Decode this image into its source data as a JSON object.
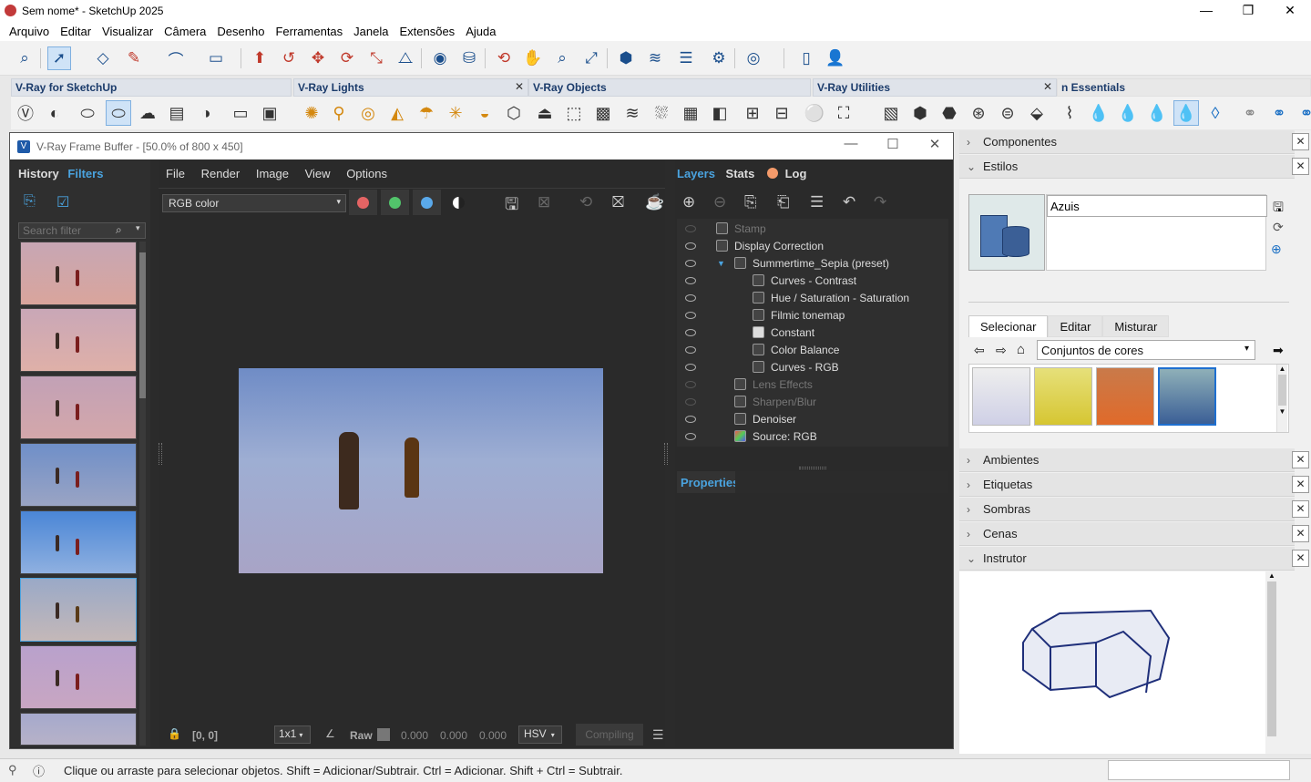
{
  "window": {
    "title": "Sem nome* - SketchUp 2025"
  },
  "menu": [
    "Arquivo",
    "Editar",
    "Visualizar",
    "Câmera",
    "Desenho",
    "Ferramentas",
    "Janela",
    "Extensões",
    "Ajuda"
  ],
  "toolbars": {
    "vray_sketchup": "V-Ray for SketchUp",
    "vray_lights": "V-Ray Lights",
    "vray_objects": "V-Ray Objects",
    "vray_utilities": "V-Ray Utilities",
    "essentials": "n Essentials",
    "close_glyph": "✕"
  },
  "vfb": {
    "title": "V-Ray Frame Buffer - [50.0% of 800 x 450]",
    "left_tabs": [
      "History",
      "Filters"
    ],
    "search_placeholder": "Search filter",
    "menu": [
      "File",
      "Render",
      "Image",
      "View",
      "Options"
    ],
    "channel": "RGB color",
    "right_tabs": [
      "Layers",
      "Stats",
      "Log"
    ],
    "layers": [
      {
        "label": "Stamp",
        "dim": true
      },
      {
        "label": "Display Correction",
        "dim": false
      },
      {
        "label": "Summertime_Sepia (preset)",
        "dim": false
      },
      {
        "label": "Curves - Contrast",
        "dim": false
      },
      {
        "label": "Hue / Saturation - Saturation",
        "dim": false
      },
      {
        "label": "Filmic tonemap",
        "dim": false
      },
      {
        "label": "Constant",
        "dim": false
      },
      {
        "label": "Color Balance",
        "dim": false
      },
      {
        "label": "Curves - RGB",
        "dim": false
      },
      {
        "label": "Lens Effects",
        "dim": true
      },
      {
        "label": "Sharpen/Blur",
        "dim": true
      },
      {
        "label": "Denoiser",
        "dim": false
      },
      {
        "label": "Source: RGB",
        "dim": false
      }
    ],
    "properties_label": "Properties",
    "bottom": {
      "coords": "[0, 0]",
      "zoom": "1x1",
      "raw": "Raw",
      "v1": "0.000",
      "v2": "0.000",
      "v3": "0.000",
      "colorspace": "HSV",
      "status": "Compiling"
    }
  },
  "tray": {
    "componentes": "Componentes",
    "estilos": "Estilos",
    "style_name": "Azuis",
    "tabs": [
      "Selecionar",
      "Editar",
      "Misturar"
    ],
    "collection": "Conjuntos de cores",
    "ambientes": "Ambientes",
    "etiquetas": "Etiquetas",
    "sombras": "Sombras",
    "cenas": "Cenas",
    "instrutor": "Instrutor"
  },
  "status": {
    "text": "Clique ou arraste para selecionar objetos. Shift = Adicionar/Subtrair. Ctrl = Adicionar. Shift + Ctrl = Subtrair."
  },
  "colors": {
    "accent": "#4aa3df",
    "vfb_bg": "#2b2b2b",
    "style_selected": "#1e6fd0"
  }
}
